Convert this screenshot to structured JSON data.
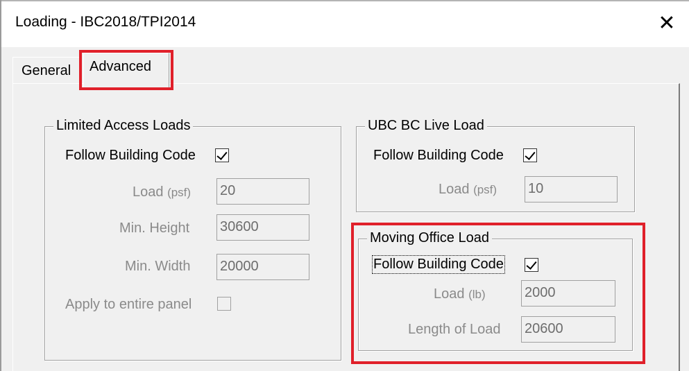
{
  "window": {
    "title": "Loading - IBC2018/TPI2014",
    "close_icon": "close-icon"
  },
  "tabs": [
    {
      "label": "General",
      "selected": false
    },
    {
      "label": "Advanced",
      "selected": true
    }
  ],
  "limited_access": {
    "title": "Limited Access Loads",
    "follow_label": "Follow Building Code",
    "follow_checked": true,
    "load_label": "Load",
    "load_unit": "(psf)",
    "load_value": "20",
    "min_height_label": "Min. Height",
    "min_height_value": "30600",
    "min_width_label": "Min. Width",
    "min_width_value": "20000",
    "apply_label": "Apply to entire panel",
    "apply_checked": false
  },
  "ubc_live": {
    "title": "UBC BC Live Load",
    "follow_label": "Follow Building Code",
    "follow_checked": true,
    "load_label": "Load",
    "load_unit": "(psf)",
    "load_value": "10"
  },
  "moving_office": {
    "title": "Moving Office Load",
    "follow_label": "Follow Building Code",
    "follow_checked": true,
    "load_label": "Load",
    "load_unit": "(lb)",
    "load_value": "2000",
    "length_label": "Length of Load",
    "length_value": "20600"
  },
  "colors": {
    "highlight": "#e0202a",
    "disabled_text": "#8a8a8a"
  }
}
